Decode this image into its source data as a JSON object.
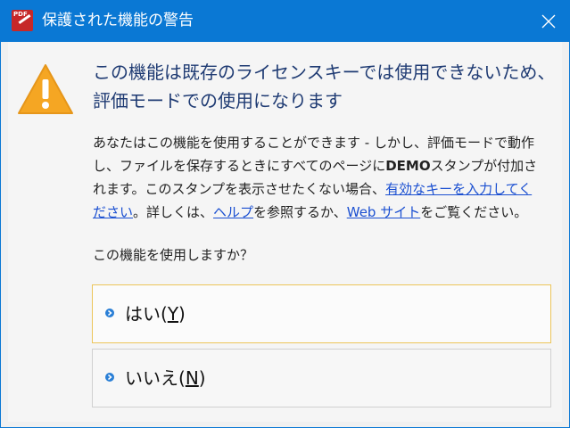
{
  "window": {
    "title": "保護された機能の警告",
    "app_icon_text": "PDF"
  },
  "message": {
    "heading": "この機能は既存のライセンスキーでは使用できないため、評価モードでの使用になります",
    "body": [
      {
        "type": "text",
        "value": "あなたはこの機能を使用することができます - しかし、評価モードで動作し、ファイルを保存するときにすべてのページに"
      },
      {
        "type": "bold",
        "value": "DEMO"
      },
      {
        "type": "text",
        "value": "スタンプが付加されます。このスタンプを表示させたくない場合、"
      },
      {
        "type": "link",
        "value": "有効なキーを入力してください"
      },
      {
        "type": "text",
        "value": "。詳しくは、"
      },
      {
        "type": "link",
        "value": "ヘルプ"
      },
      {
        "type": "text",
        "value": "を参照するか、"
      },
      {
        "type": "link",
        "value": "Web サイト"
      },
      {
        "type": "text",
        "value": "をご覧ください。"
      }
    ],
    "question": "この機能を使用しますか？"
  },
  "buttons": {
    "yes": {
      "label": "はい(",
      "accel": "Y",
      "close": ")"
    },
    "no": {
      "label": "いいえ(",
      "accel": "N",
      "close": ")"
    }
  },
  "colors": {
    "titlebar": "#0a78d4",
    "heading": "#1f3b73",
    "link": "#1a4fd1",
    "focus_border": "#ecc55a"
  },
  "icons": {
    "warning": "warning-icon",
    "close": "close-icon",
    "chevron": "chevron-right-icon"
  }
}
